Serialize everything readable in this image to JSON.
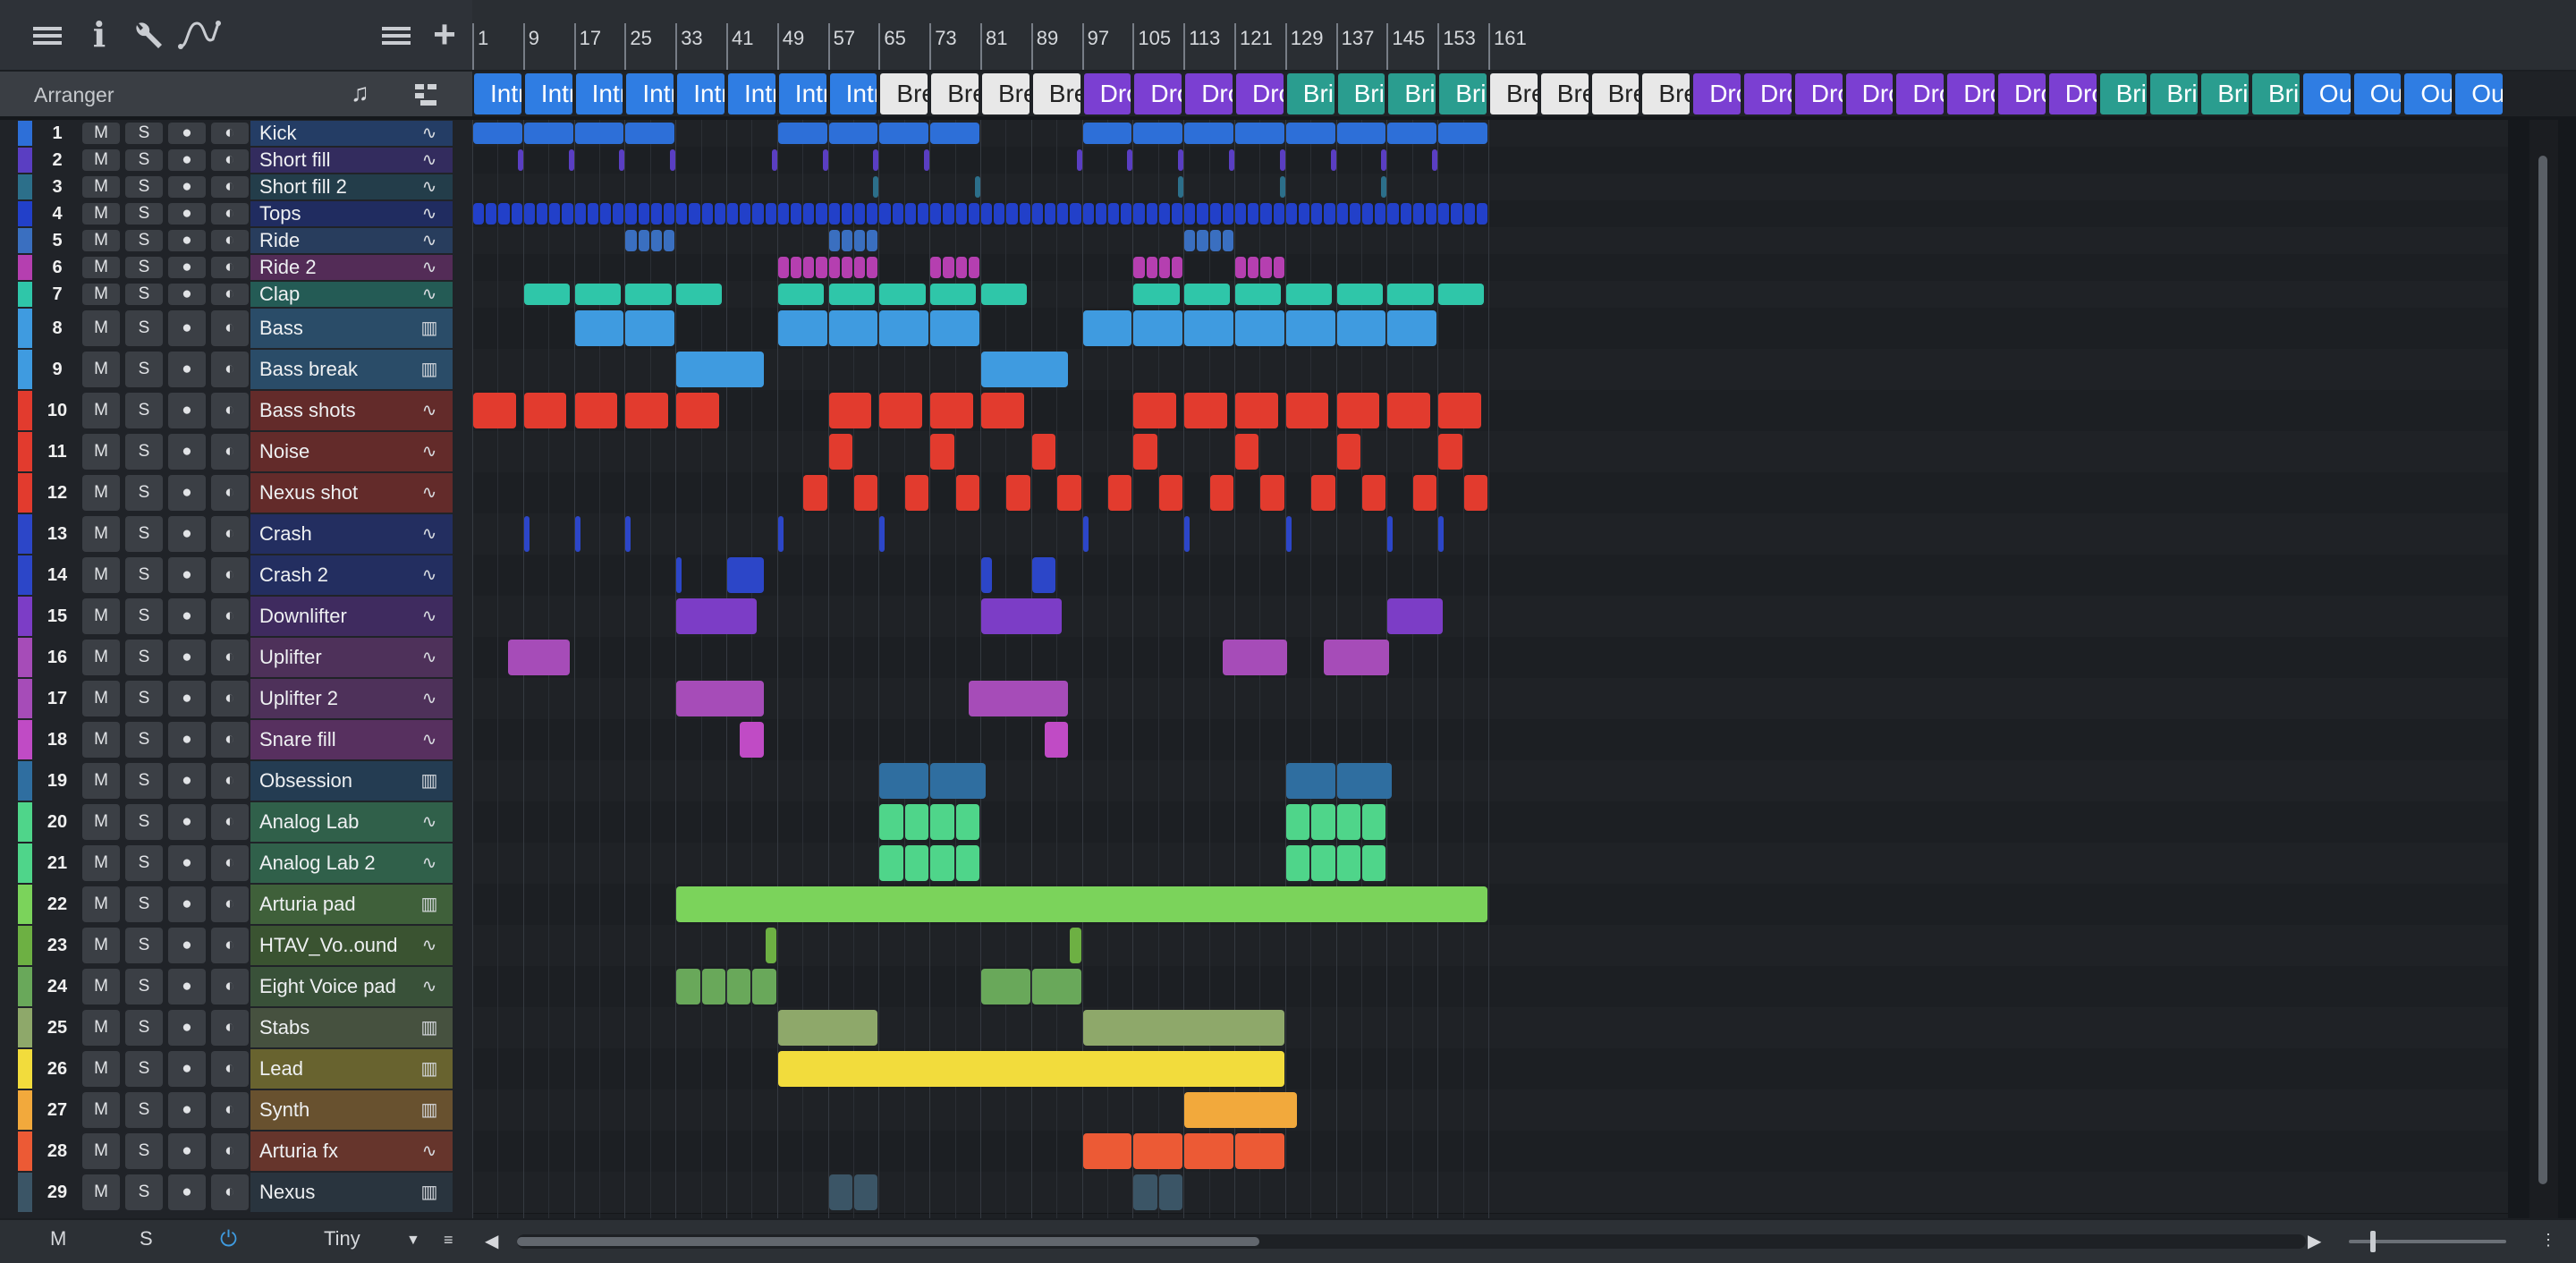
{
  "toolbar": {
    "icons": [
      "menu-icon",
      "info-icon",
      "wrench-icon",
      "automation-curve-icon"
    ],
    "right_icons": [
      "list-icon",
      "add-track-icon"
    ]
  },
  "arranger": {
    "title": "Arranger",
    "icons": [
      "music-note-icon",
      "arranger-edit-icon"
    ]
  },
  "ruler": {
    "bars": [
      "1",
      "9",
      "17",
      "25",
      "33",
      "41",
      "49",
      "57",
      "65",
      "73",
      "81",
      "89",
      "97",
      "105",
      "113",
      "121",
      "129",
      "137",
      "145",
      "153",
      "161"
    ]
  },
  "sections": [
    {
      "label": "Intro",
      "color": "#2f7de3",
      "count": 8
    },
    {
      "label": "Break",
      "color": "#e8e8e8",
      "count": 4
    },
    {
      "label": "Drop",
      "color": "#7b3fd2",
      "count": 4
    },
    {
      "label": "Bridge",
      "color": "#2a9d8f",
      "count": 4
    },
    {
      "label": "Break",
      "color": "#e8e8e8",
      "count": 4
    },
    {
      "label": "Drop",
      "color": "#7b3fd2",
      "count": 8
    },
    {
      "label": "Bridge",
      "color": "#2a9d8f",
      "count": 4
    },
    {
      "label": "Outro",
      "color": "#2f7de3",
      "count": 4
    }
  ],
  "track_buttons": {
    "mute": "M",
    "solo": "S",
    "record": "●",
    "monitor": "◐"
  },
  "tracks": [
    {
      "num": "1",
      "name": "Kick",
      "color": "#2d6fd8",
      "type": "audio",
      "small": true
    },
    {
      "num": "2",
      "name": "Short fill",
      "color": "#5a3ec2",
      "type": "audio",
      "small": true
    },
    {
      "num": "3",
      "name": "Short fill 2",
      "color": "#2c6f8a",
      "type": "audio",
      "small": true
    },
    {
      "num": "4",
      "name": "Tops",
      "color": "#2240c9",
      "type": "audio",
      "small": true
    },
    {
      "num": "5",
      "name": "Ride",
      "color": "#3a6fc0",
      "type": "audio",
      "small": true
    },
    {
      "num": "6",
      "name": "Ride 2",
      "color": "#b53fb0",
      "type": "audio",
      "small": true
    },
    {
      "num": "7",
      "name": "Clap",
      "color": "#2fc6a9",
      "type": "audio",
      "small": true
    },
    {
      "num": "8",
      "name": "Bass",
      "color": "#3f9be0",
      "type": "instrument",
      "small": false
    },
    {
      "num": "9",
      "name": "Bass break",
      "color": "#3f9be0",
      "type": "instrument",
      "small": false
    },
    {
      "num": "10",
      "name": "Bass shots",
      "color": "#e23b2e",
      "type": "audio",
      "small": false
    },
    {
      "num": "11",
      "name": "Noise",
      "color": "#e23b2e",
      "type": "audio",
      "small": false
    },
    {
      "num": "12",
      "name": "Nexus shot",
      "color": "#e23b2e",
      "type": "audio",
      "small": false
    },
    {
      "num": "13",
      "name": "Crash",
      "color": "#2c46c8",
      "type": "audio",
      "small": false
    },
    {
      "num": "14",
      "name": "Crash 2",
      "color": "#2c46c8",
      "type": "audio",
      "small": false
    },
    {
      "num": "15",
      "name": "Downlifter",
      "color": "#7c3dc6",
      "type": "audio",
      "small": false
    },
    {
      "num": "16",
      "name": "Uplifter",
      "color": "#a64cb8",
      "type": "audio",
      "small": false
    },
    {
      "num": "17",
      "name": "Uplifter 2",
      "color": "#a64cb8",
      "type": "audio",
      "small": false
    },
    {
      "num": "18",
      "name": "Snare fill",
      "color": "#c04bc5",
      "type": "audio",
      "small": false
    },
    {
      "num": "19",
      "name": "Obsession",
      "color": "#2f6ea0",
      "type": "instrument",
      "small": false
    },
    {
      "num": "20",
      "name": "Analog Lab",
      "color": "#4fd58a",
      "type": "audio",
      "small": false
    },
    {
      "num": "21",
      "name": "Analog Lab 2",
      "color": "#4fd58a",
      "type": "audio",
      "small": false
    },
    {
      "num": "22",
      "name": "Arturia pad",
      "color": "#7bd35b",
      "type": "instrument",
      "small": false
    },
    {
      "num": "23",
      "name": "HTAV_Vo..ound",
      "color": "#6db043",
      "type": "audio",
      "small": false
    },
    {
      "num": "24",
      "name": "Eight Voice pad",
      "color": "#69a85a",
      "type": "audio",
      "small": false
    },
    {
      "num": "25",
      "name": "Stabs",
      "color": "#8ea86a",
      "type": "instrument",
      "small": false
    },
    {
      "num": "26",
      "name": "Lead",
      "color": "#f2dc3c",
      "type": "instrument",
      "small": false
    },
    {
      "num": "27",
      "name": "Synth",
      "color": "#f2a93c",
      "type": "instrument",
      "small": false
    },
    {
      "num": "28",
      "name": "Arturia fx",
      "color": "#ec5a35",
      "type": "audio",
      "small": false
    },
    {
      "num": "29",
      "name": "Nexus",
      "color": "#3b5566",
      "type": "instrument",
      "small": false
    }
  ],
  "bottom": {
    "mute_all": "M",
    "solo_all": "S",
    "size_label": "Tiny"
  }
}
